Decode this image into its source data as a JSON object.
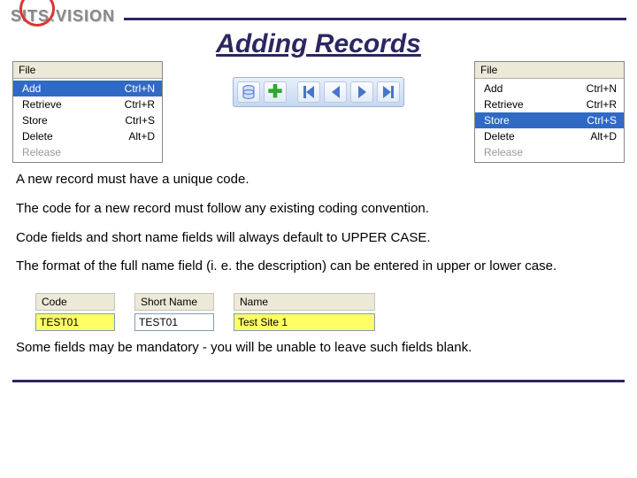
{
  "brand": {
    "left": "SITS",
    "right": "VISION"
  },
  "title": "Adding Records",
  "menu_left": {
    "title": "File",
    "items": [
      {
        "label": "Add",
        "shortcut": "Ctrl+N",
        "state": "hl"
      },
      {
        "label": "Retrieve",
        "shortcut": "Ctrl+R",
        "state": ""
      },
      {
        "label": "Store",
        "shortcut": "Ctrl+S",
        "state": ""
      },
      {
        "label": "Delete",
        "shortcut": "Alt+D",
        "state": ""
      },
      {
        "label": "Release",
        "shortcut": "",
        "state": "disabled"
      }
    ]
  },
  "menu_right": {
    "title": "File",
    "items": [
      {
        "label": "Add",
        "shortcut": "Ctrl+N",
        "state": ""
      },
      {
        "label": "Retrieve",
        "shortcut": "Ctrl+R",
        "state": ""
      },
      {
        "label": "Store",
        "shortcut": "Ctrl+S",
        "state": "hl"
      },
      {
        "label": "Delete",
        "shortcut": "Alt+D",
        "state": ""
      },
      {
        "label": "Release",
        "shortcut": "",
        "state": "disabled"
      }
    ]
  },
  "paragraphs": {
    "p1": "A new record must have a unique code.",
    "p2": "The code for a new record must follow any existing coding convention.",
    "p3": "Code fields and short name fields will always default to UPPER CASE.",
    "p4": "The format of the full name field (i. e. the description) can be entered in upper or lower case.",
    "p5": "Some fields may be mandatory - you will be unable to leave such fields blank."
  },
  "fields": {
    "labels": {
      "code": "Code",
      "short": "Short Name",
      "name": "Name"
    },
    "values": {
      "code": "TEST01",
      "short": "TEST01",
      "name": "Test Site 1"
    }
  }
}
